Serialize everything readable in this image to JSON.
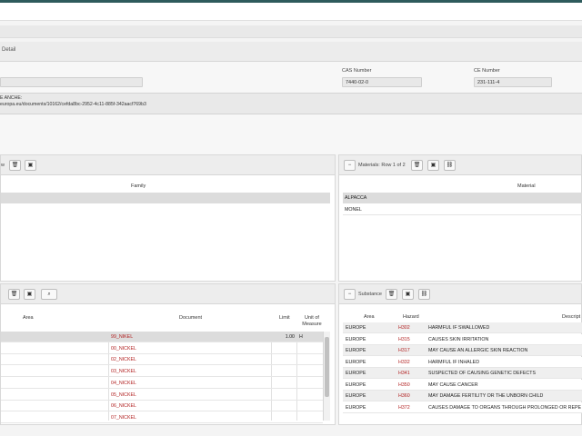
{
  "detail_tab": {
    "label": "Detail"
  },
  "form": {
    "cas_label": "CAS Number",
    "cas_value": "7440-02-0",
    "ce_label": "CE Number",
    "ce_value": "231-111-4",
    "notes_line1": "E ANCHE:",
    "notes_line2": "europa.eu/documents/10162/cefda8bc-2952-4c11-885f-342aacf769b3"
  },
  "families_panel": {
    "toolbar_label": "w",
    "col_family": "Family"
  },
  "materials_panel": {
    "toolbar_label": "Materials: Row 1 of 2",
    "col_material": "Material",
    "rows": [
      "ALPACCA",
      "MONEL"
    ]
  },
  "documents_panel": {
    "col_area": "Area",
    "col_document": "Document",
    "col_limit": "Limit",
    "col_unit": "Unit of Measure",
    "rows": [
      {
        "document": "99_NIKEL",
        "limit": "1.00",
        "unit": "H"
      },
      {
        "document": "00_NICKEL",
        "limit": "",
        "unit": ""
      },
      {
        "document": "02_NICKEL",
        "limit": "",
        "unit": ""
      },
      {
        "document": "03_NICKEL",
        "limit": "",
        "unit": ""
      },
      {
        "document": "04_NICKEL",
        "limit": "",
        "unit": ""
      },
      {
        "document": "05_NICKEL",
        "limit": "",
        "unit": ""
      },
      {
        "document": "06_NICKEL",
        "limit": "",
        "unit": ""
      },
      {
        "document": "07_NICKEL",
        "limit": "",
        "unit": ""
      }
    ]
  },
  "substance_panel": {
    "toolbar_label": "Substance",
    "col_area": "Area",
    "col_hazard": "Hazard",
    "col_description": "Descript",
    "rows": [
      {
        "area": "EUROPE",
        "hazard": "H302",
        "description": "HARMFUL IF SWALLOWED"
      },
      {
        "area": "EUROPE",
        "hazard": "H315",
        "description": "CAUSES SKIN IRRITATION"
      },
      {
        "area": "EUROPE",
        "hazard": "H317",
        "description": "MAY CAUSE AN ALLERGIC SKIN REACTION"
      },
      {
        "area": "EUROPE",
        "hazard": "H332",
        "description": "HARMFUL IF INHALED"
      },
      {
        "area": "EUROPE",
        "hazard": "H341",
        "description": "SUSPECTED OF CAUSING GENETIC DEFECTS"
      },
      {
        "area": "EUROPE",
        "hazard": "H350",
        "description": "MAY CAUSE CANCER"
      },
      {
        "area": "EUROPE",
        "hazard": "H360",
        "description": "MAY DAMAGE FERTILITY OR THE UNBORN CHILD"
      },
      {
        "area": "EUROPE",
        "hazard": "H372",
        "description": "CAUSES DAMAGE TO ORGANS THROUGH PROLONGED OR REPE"
      }
    ]
  },
  "colors": {
    "header": "#2e5b5c",
    "hazard_code": "#b22222",
    "document_link": "#b22222"
  },
  "icons": {
    "delete": "trash-icon",
    "save": "floppy-disk-icon",
    "link": "link-icon",
    "collapse": "minus-icon",
    "search": "search-icon"
  }
}
